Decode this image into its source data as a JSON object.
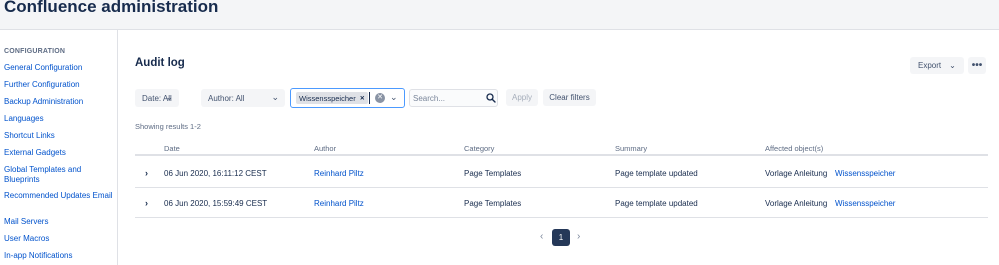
{
  "app": {
    "title": "Confluence administration"
  },
  "sidebar": {
    "heading": "CONFIGURATION",
    "items": [
      {
        "label": "General Configuration"
      },
      {
        "label": "Further Configuration"
      },
      {
        "label": "Backup Administration"
      },
      {
        "label": "Languages"
      },
      {
        "label": "Shortcut Links"
      },
      {
        "label": "External Gadgets"
      },
      {
        "label": "Global Templates and Blueprints"
      },
      {
        "label": "Recommended Updates Email"
      },
      {
        "label": "Mail Servers"
      },
      {
        "label": "User Macros"
      },
      {
        "label": "In-app Notifications"
      }
    ]
  },
  "main": {
    "title": "Audit log",
    "export_label": "Export",
    "more_label": "•••",
    "filters": {
      "date_label": "Date: All",
      "author_label": "Author: All",
      "category_tag": "Wissensspeicher",
      "search_placeholder": "Search...",
      "search_value": "",
      "apply_label": "Apply",
      "clear_label": "Clear filters"
    },
    "showing": "Showing results 1-2",
    "columns": [
      "Date",
      "Author",
      "Category",
      "Summary",
      "Affected object(s)"
    ],
    "rows": [
      {
        "date": "06 Jun 2020, 16:11:12 CEST",
        "author": "Reinhard Piltz",
        "category": "Page Templates",
        "summary": "Page template updated",
        "object1": "Vorlage Anleitung",
        "object2": "Wissensspeicher"
      },
      {
        "date": "06 Jun 2020, 15:59:49 CEST",
        "author": "Reinhard Piltz",
        "category": "Page Templates",
        "summary": "Page template updated",
        "object1": "Vorlage Anleitung",
        "object2": "Wissensspeicher"
      }
    ],
    "pagination": {
      "current": "1"
    }
  },
  "icons": {
    "chevron_down": "chevron-down-icon",
    "chevron_right": "chevron-right-icon",
    "chevron_left": "chevron-left-icon",
    "search": "search-icon",
    "close": "close-icon",
    "more": "more-icon"
  },
  "colors": {
    "link": "#0052cc",
    "text": "#172b4d",
    "focus": "#4c9aff",
    "current_page": "#253858"
  }
}
